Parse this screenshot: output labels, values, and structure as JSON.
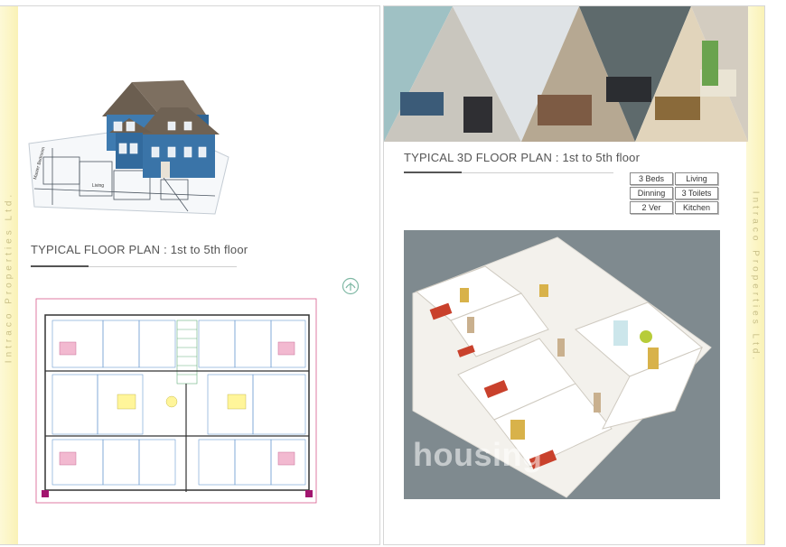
{
  "left_page": {
    "floor_plan_title": "TYPICAL FLOOR PLAN : 1st to 5th floor",
    "side_text": "Intraco Properties Ltd."
  },
  "right_page": {
    "floor_plan_3d_title": "TYPICAL 3D FLOOR PLAN : 1st to 5th floor",
    "side_text": "Intraco Properties Ltd.",
    "features": [
      "3 Beds",
      "Living",
      "Dinning",
      "3 Toilets",
      "2 Ver",
      "Kitchen"
    ],
    "watermark": "housing"
  },
  "colors": {
    "strip": "#faf2b6",
    "plan_bg": "#7f8a8f",
    "house_blue": "#3a74a8",
    "roof": "#6b5e50"
  }
}
